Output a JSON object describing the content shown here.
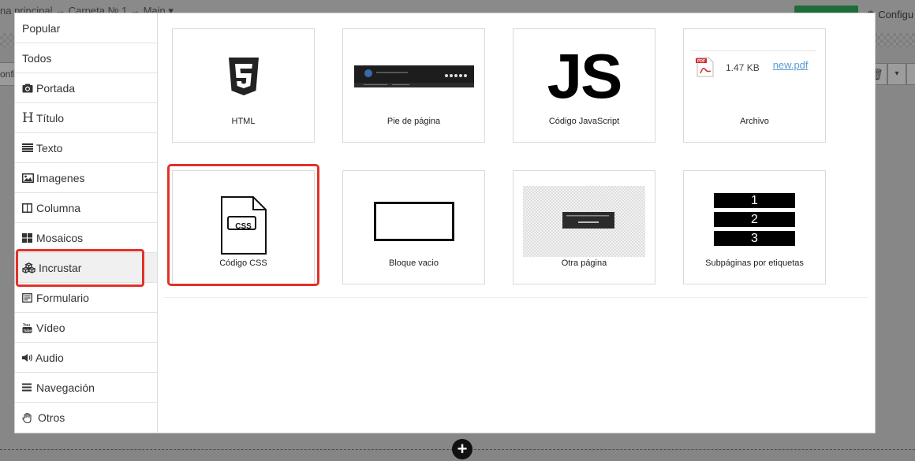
{
  "background": {
    "breadcrumb": "na principal → Carpeta № 1 → Main ▾",
    "config_label": "Configu",
    "left_tab_label": "onfig",
    "trash_symbol": "🗑",
    "dropdown_symbol": "▾",
    "plus_symbol": "+"
  },
  "sidebar": {
    "items": [
      {
        "label": "Popular",
        "icon": "none"
      },
      {
        "label": "Todos",
        "icon": "none"
      },
      {
        "label": "Portada",
        "icon": "camera-icon"
      },
      {
        "label": "Título",
        "icon": "heading-icon",
        "glyph": "H"
      },
      {
        "label": "Texto",
        "icon": "text-lines-icon"
      },
      {
        "label": "Imagenes",
        "icon": "image-icon"
      },
      {
        "label": "Columna",
        "icon": "columns-icon"
      },
      {
        "label": "Mosaicos",
        "icon": "tiles-icon"
      },
      {
        "label": "Incrustar",
        "icon": "cubes-icon"
      },
      {
        "label": "Formulario",
        "icon": "form-icon"
      },
      {
        "label": "Vídeo",
        "icon": "youtube-icon"
      },
      {
        "label": "Audio",
        "icon": "volume-icon"
      },
      {
        "label": "Navegación",
        "icon": "menu-icon"
      },
      {
        "label": "Otros",
        "icon": "hand-icon"
      }
    ],
    "active_item": "Incrustar"
  },
  "cards": [
    {
      "label": "HTML",
      "icon": "html5-icon"
    },
    {
      "label": "Pie de página",
      "icon": "footer-preview"
    },
    {
      "label": "Código JavaScript",
      "icon": "js-icon",
      "glyph": "JS"
    },
    {
      "label": "Archivo",
      "icon": "pdf-file-icon",
      "file_size": "1.47 KB",
      "file_name": "new.pdf"
    },
    {
      "label": "Código CSS",
      "icon": "css-file-icon",
      "glyph": "CSS"
    },
    {
      "label": "Bloque vacio",
      "icon": "empty-block-icon"
    },
    {
      "label": "Otra página",
      "icon": "other-page-preview"
    },
    {
      "label": "Subpáginas por etiquetas",
      "icon": "numbered-list-icon",
      "numbers": [
        "1",
        "2",
        "3"
      ]
    }
  ],
  "highlights": {
    "color": "#e0322a",
    "sidebar_item": "Incrustar",
    "card": "Código CSS"
  }
}
